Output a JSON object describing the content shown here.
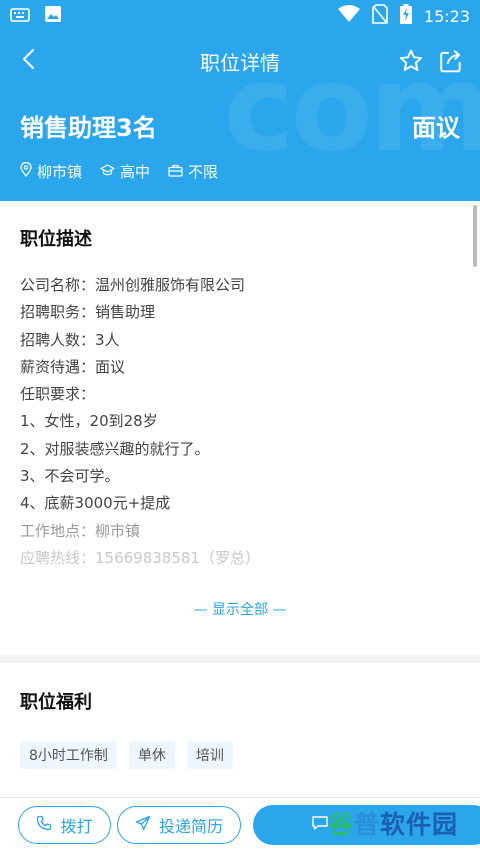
{
  "statusbar": {
    "time": "15:23"
  },
  "header": {
    "title": "职位详情",
    "watermark": "com"
  },
  "job": {
    "title": "销售助理3名",
    "salary": "面议",
    "meta": [
      {
        "icon": "location-pin-icon",
        "label": "柳市镇"
      },
      {
        "icon": "education-icon",
        "label": "高中"
      },
      {
        "icon": "briefcase-icon",
        "label": "不限"
      }
    ]
  },
  "description": {
    "section_title": "职位描述",
    "lines": [
      "公司名称：温州创雅服饰有限公司",
      "招聘职务：销售助理",
      "招聘人数：3人",
      "薪资待遇：面议",
      "任职要求：",
      "1、女性，20到28岁",
      "2、对服装感兴趣的就行了。",
      "3、不会可学。",
      "4、底薪3000元+提成",
      "工作地点：柳市镇",
      "应聘热线：15669838581（罗总）"
    ],
    "show_all": "— 显示全部 —"
  },
  "benefits": {
    "section_title": "职位福利",
    "tags": [
      "8小时工作制",
      "单休",
      "培训"
    ]
  },
  "bottom": {
    "call_label": "拨打",
    "apply_label": "投递简历"
  },
  "watermark_badge": {
    "part1": "谷",
    "part2": "普",
    "part3": "软件园"
  },
  "colors": {
    "primary": "#2aa6ec",
    "tag_bg": "#edf6fc"
  }
}
